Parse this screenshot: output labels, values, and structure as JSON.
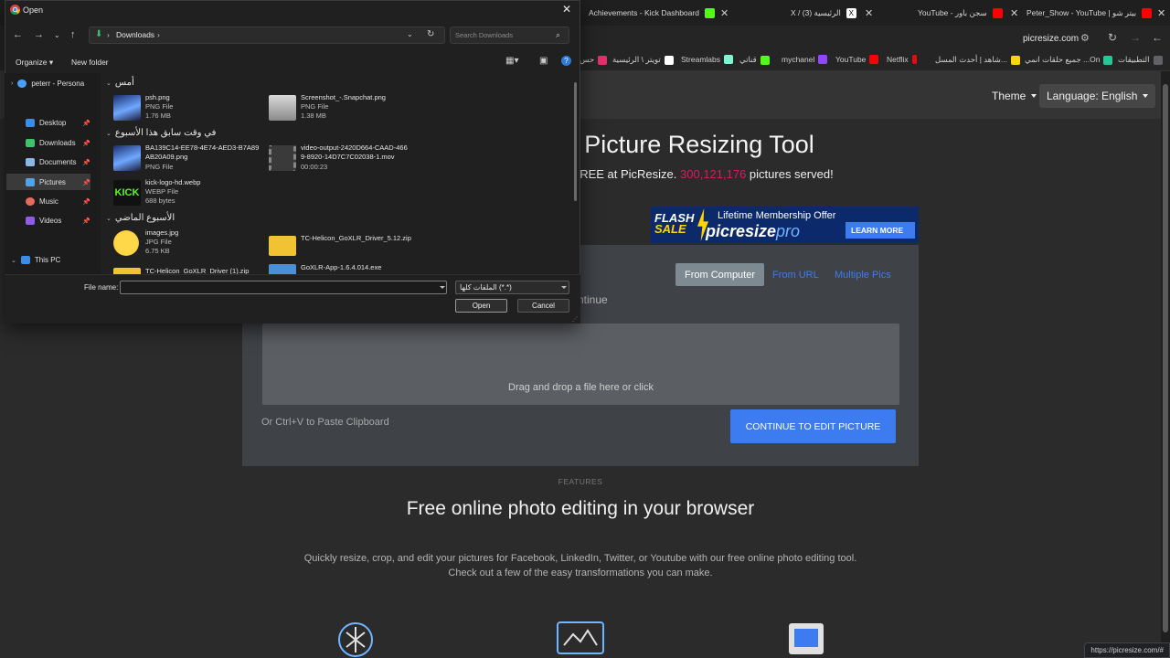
{
  "tabs": [
    {
      "label": "Achievements - Kick Dashboard",
      "color": "#53fc18"
    },
    {
      "label": "X / الرئيسية (3)",
      "color": "#ffffff"
    },
    {
      "label": "YouTube - سجن باور",
      "color": "#ff0000"
    },
    {
      "label": "Peter_Show - YouTube | بيتر شو",
      "color": "#ff0000"
    }
  ],
  "address_bar": {
    "url": "picresize.com"
  },
  "bookmarks": [
    {
      "label": "التطبيقات",
      "color": "#5f6368"
    },
    {
      "label": "جميع حلقات انمي ...On",
      "color": "#20c997"
    },
    {
      "label": "شاهد | أحدث المسل...",
      "color": "#ffd600"
    },
    {
      "label": "Netflix",
      "color": "#e50914"
    },
    {
      "label": "YouTube",
      "color": "#ff0000"
    },
    {
      "label": "mychanel",
      "color": "#9146ff"
    },
    {
      "label": "قناتي",
      "color": "#53fc18"
    },
    {
      "label": "Streamlabs",
      "color": "#80f5d2"
    },
    {
      "label": "تويتر \\ الرئيسية",
      "color": "#ffffff"
    },
    {
      "label": "حس",
      "color": "#e1306c"
    }
  ],
  "site": {
    "theme_label": "Theme",
    "language_label": "Language: English",
    "hero_title": "Picture Resizing Tool",
    "hero_sub_prefix": "r FREE at PicResize. ",
    "hero_count": "300,121,176",
    "hero_sub_suffix": " pictures served!",
    "banner": {
      "flash": "FLASH",
      "sale": "SALE",
      "offer": "Lifetime Membership Offer",
      "logo_a": "picresize",
      "logo_b": "pro",
      "learn": "LEARN MORE"
    },
    "source_tabs": {
      "computer": "From Computer",
      "url": "From URL",
      "multi": "Multiple Pics"
    },
    "continue_hint": "ntinue",
    "dropzone_text": "Drag and drop a file here or click",
    "paste_hint": "Or Ctrl+V to Paste Clipboard",
    "continue_button": "CONTINUE TO EDIT PICTURE",
    "features_label": "FEATURES",
    "features_title": "Free online photo editing in your browser",
    "features_desc1": "Quickly resize, crop, and edit your pictures for Facebook, LinkedIn, Twitter, or Youtube with our free online photo editing tool.",
    "features_desc2": "Check out a few of the easy transformations you can make.",
    "status_url": "https://picresize.com/#"
  },
  "dialog": {
    "title": "Open",
    "path": "Downloads",
    "search_placeholder": "Search Downloads",
    "organize": "Organize",
    "new_folder": "New folder",
    "nav": {
      "onedrive": "peterr - Persona",
      "desktop": "Desktop",
      "downloads": "Downloads",
      "documents": "Documents",
      "pictures": "Pictures",
      "music": "Music",
      "videos": "Videos",
      "thispc": "This PC"
    },
    "groups": {
      "yesterday": "أمس",
      "earlier_week": "في وقت سابق هذا الأسبوع",
      "last_week": "الأسبوع الماضي"
    },
    "files": [
      {
        "name": "psh.png",
        "type": "PNG File",
        "size": "1.76 MB"
      },
      {
        "name": "Screenshot_-.Snapchat.png",
        "type": "PNG File",
        "size": "1.38 MB"
      },
      {
        "name": "BA139C14-EE78-4E74-AED3-B7A89",
        "name2": "AB20A09.png",
        "type": "PNG File"
      },
      {
        "name": "video-output-2420D664-CAAD-466",
        "name2": "9-8920-14D7C7C02038-1.mov",
        "type": "00:00:23"
      },
      {
        "name": "kick-logo-hd.webp",
        "type": "WEBP File",
        "size": "688 bytes"
      },
      {
        "name": "images.jpg",
        "type": "JPG File",
        "size": "6.75 KB"
      },
      {
        "name": "TC-Helicon_GoXLR_Driver_5.12.zip"
      },
      {
        "name": "TC-Helicon_GoXLR_Driver (1).zip"
      },
      {
        "name": "GoXLR-App-1.6.4.014.exe"
      }
    ],
    "filename_label": "File name:",
    "filename_value": "",
    "filetype": "الملفات كلها (*.*)",
    "open_button": "Open",
    "cancel_button": "Cancel"
  }
}
